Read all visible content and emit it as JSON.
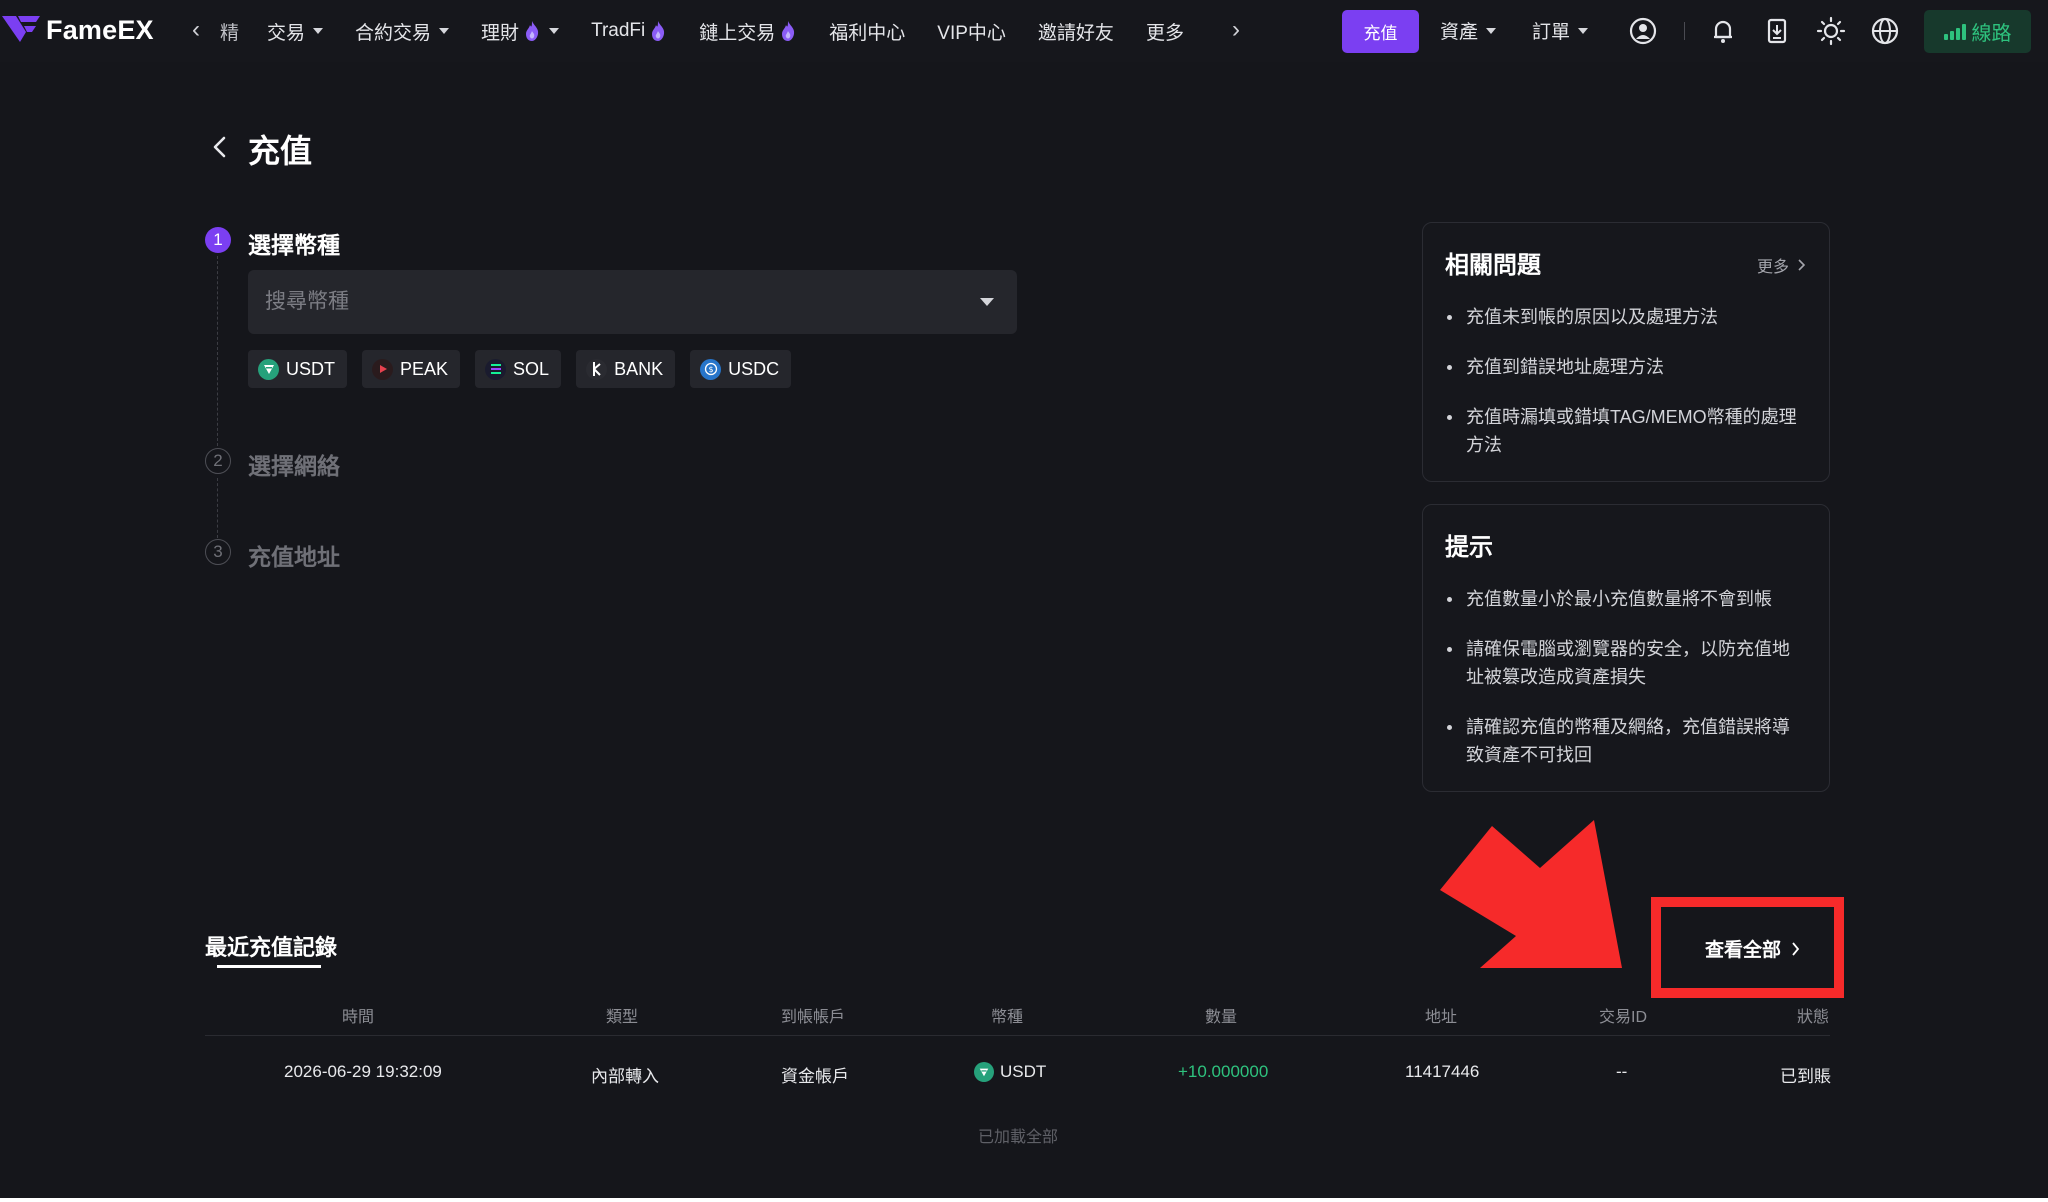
{
  "brand": {
    "name": "FameEX",
    "accent": "#7b3ff2",
    "success": "#2ec27e",
    "highlight": "#f62a2a"
  },
  "nav": {
    "partial_item": "精",
    "items": [
      {
        "label": "交易",
        "caret": true,
        "fire": false
      },
      {
        "label": "合約交易",
        "caret": true,
        "fire": false
      },
      {
        "label": "理財",
        "caret": true,
        "fire": true
      },
      {
        "label": "TradFi",
        "caret": false,
        "fire": true
      },
      {
        "label": "鏈上交易",
        "caret": false,
        "fire": true
      },
      {
        "label": "福利中心",
        "caret": false,
        "fire": false
      },
      {
        "label": "VIP中心",
        "caret": false,
        "fire": false
      },
      {
        "label": "邀請好友",
        "caret": false,
        "fire": false
      },
      {
        "label": "更多",
        "caret": false,
        "fire": false
      }
    ],
    "deposit_button": "充值",
    "assets": "資產",
    "orders": "訂單",
    "route": "線路",
    "icons": [
      "user-icon",
      "bell-icon",
      "download-icon",
      "theme-sun-icon",
      "globe-icon"
    ]
  },
  "page": {
    "title": "充值"
  },
  "steps": [
    {
      "num": "1",
      "title": "選擇幣種",
      "active": true
    },
    {
      "num": "2",
      "title": "選擇網絡",
      "active": false
    },
    {
      "num": "3",
      "title": "充值地址",
      "active": false
    }
  ],
  "coin_select": {
    "placeholder": "搜尋幣種"
  },
  "coins": [
    {
      "symbol": "USDT",
      "icon": "usdt-icon",
      "color": "#26a17b"
    },
    {
      "symbol": "PEAK",
      "icon": "peak-icon",
      "color": "#e8424f"
    },
    {
      "symbol": "SOL",
      "icon": "sol-icon",
      "color": "#1a1b2e"
    },
    {
      "symbol": "BANK",
      "icon": "bank-icon",
      "color": "#2a2b31"
    },
    {
      "symbol": "USDC",
      "icon": "usdc-icon",
      "color": "#2775ca"
    }
  ],
  "faq": {
    "title": "相關問題",
    "more": "更多",
    "items": [
      "充值未到帳的原因以及處理方法",
      "充值到錯誤地址處理方法",
      "充值時漏填或錯填TAG/MEMO幣種的處理方法"
    ]
  },
  "tips": {
    "title": "提示",
    "items": [
      "充值數量小於最小充值數量將不會到帳",
      "請確保電腦或瀏覽器的安全，以防充值地址被篡改造成資產損失",
      "請確認充值的幣種及網絡，充值錯誤將導致資產不可找回"
    ]
  },
  "records": {
    "title": "最近充值記錄",
    "view_all": "查看全部",
    "columns": [
      "時間",
      "類型",
      "到帳帳戶",
      "幣種",
      "數量",
      "地址",
      "交易ID",
      "狀態"
    ],
    "rows": [
      {
        "time": "2026-06-29 19:32:09",
        "type": "內部轉入",
        "account": "資金帳戶",
        "coin": "USDT",
        "amount": "+10.000000",
        "address": "11417446",
        "txid": "--",
        "status": "已到賬"
      }
    ],
    "loaded_all": "已加載全部"
  }
}
